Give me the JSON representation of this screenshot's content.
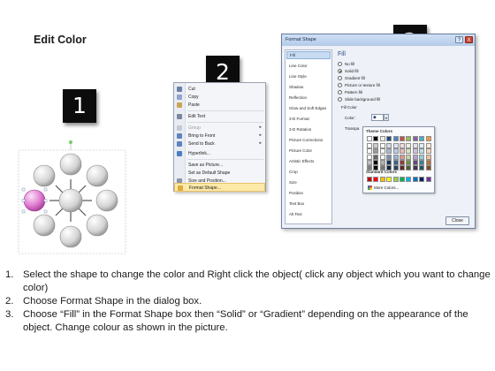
{
  "title": "Edit Color",
  "badges": [
    "1",
    "2",
    "3"
  ],
  "context_menu": {
    "items": [
      {
        "label": "Cut",
        "icon": "scissors-icon",
        "disabled": false,
        "arrow": false
      },
      {
        "label": "Copy",
        "icon": "copy-icon",
        "disabled": false,
        "arrow": false
      },
      {
        "label": "Paste",
        "icon": "paste-icon",
        "disabled": false,
        "arrow": false
      },
      {
        "label": "Edit Text",
        "icon": "edit-text-icon",
        "disabled": false,
        "arrow": false
      },
      {
        "label": "Group",
        "icon": "group-icon",
        "disabled": true,
        "arrow": true
      },
      {
        "label": "Bring to Front",
        "icon": "bring-front-icon",
        "disabled": false,
        "arrow": true
      },
      {
        "label": "Send to Back",
        "icon": "send-back-icon",
        "disabled": false,
        "arrow": true
      },
      {
        "label": "Hyperlink...",
        "icon": "hyperlink-icon",
        "disabled": false,
        "arrow": false
      },
      {
        "label": "Save as Picture...",
        "icon": "",
        "disabled": false,
        "arrow": false
      },
      {
        "label": "Set as Default Shape",
        "icon": "",
        "disabled": false,
        "arrow": false
      },
      {
        "label": "Size and Position...",
        "icon": "size-position-icon",
        "disabled": false,
        "arrow": false
      },
      {
        "label": "Format Shape...",
        "icon": "format-shape-icon",
        "disabled": false,
        "arrow": false,
        "highlight": true
      }
    ]
  },
  "dialog": {
    "title": "Format Shape",
    "help": "?",
    "close_x": "X",
    "categories": [
      "Fill",
      "Line Color",
      "Line Style",
      "Shadow",
      "Reflection",
      "Glow and Soft Edges",
      "3-D Format",
      "3-D Rotation",
      "Picture Corrections",
      "Picture Color",
      "Artistic Effects",
      "Crop",
      "Size",
      "Position",
      "Text Box",
      "Alt Text"
    ],
    "selected_category": "Fill",
    "fill_heading": "Fill",
    "fill_options": [
      "No fill",
      "Solid fill",
      "Gradient fill",
      "Picture or texture fill",
      "Pattern fill",
      "Slide background fill"
    ],
    "selected_fill": "Solid fill",
    "fill_color_heading": "Fill Color",
    "color_label": "Color:",
    "transparency_label": "Transpa",
    "close_button": "Close"
  },
  "palette": {
    "theme_heading": "Theme Colors",
    "theme_top": [
      "#ffffff",
      "#000000",
      "#eeece1",
      "#1f497d",
      "#4f81bd",
      "#c0504d",
      "#9bbb59",
      "#8064a2",
      "#4bacc6",
      "#f79646"
    ],
    "standard_heading": "Standard Colors",
    "standard": [
      "#c00000",
      "#ff0000",
      "#ffc000",
      "#ffff00",
      "#92d050",
      "#00b050",
      "#00b0f0",
      "#0070c0",
      "#002060",
      "#7030a0"
    ],
    "more_label": "More Colors..."
  },
  "instructions": [
    {
      "num": "1.",
      "text": "Select the shape to change the color and Right click the object( click any object which you want to change color)"
    },
    {
      "num": "2.",
      "text": "Choose Format Shape in the dialog box."
    },
    {
      "num": "3.",
      "text": "Choose “Fill” in the Format Shape box then “Solid” or “Gradient” depending on the appearance of the object. Change colour as shown in the picture."
    }
  ],
  "colors": {
    "selected_circle": "#e07ad0",
    "circle": "#d9d9d9",
    "accent": "#2c4c86"
  }
}
